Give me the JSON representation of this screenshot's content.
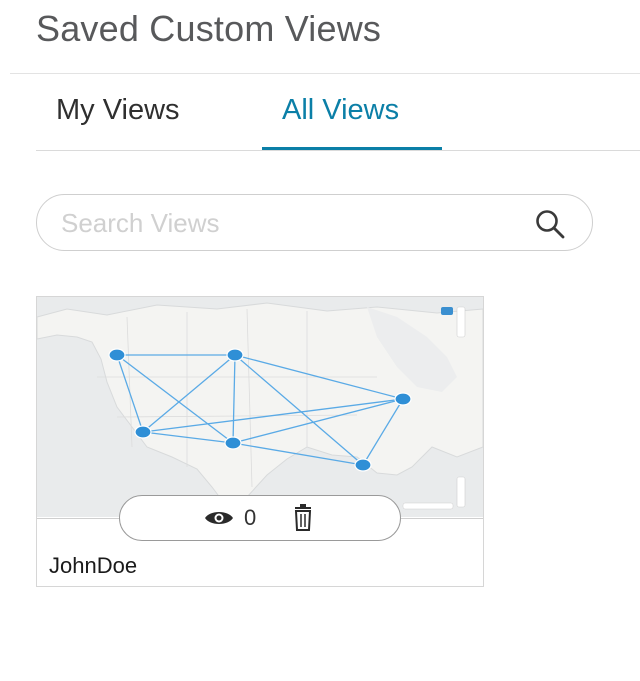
{
  "page": {
    "title": "Saved Custom Views"
  },
  "tabs": [
    {
      "label": "My Views",
      "active": false
    },
    {
      "label": "All Views",
      "active": true
    }
  ],
  "search": {
    "placeholder": "Search Views",
    "value": "",
    "icon": "search-icon"
  },
  "views": [
    {
      "owner": "JohnDoe",
      "view_count": "0",
      "thumbnail": "map-thumbnail",
      "actions": [
        "eye-icon",
        "trash-icon"
      ]
    }
  ],
  "colors": {
    "accent": "#0b7fa7",
    "title": "#58595b",
    "node": "#2f8fd6",
    "link": "#5aaae6"
  }
}
